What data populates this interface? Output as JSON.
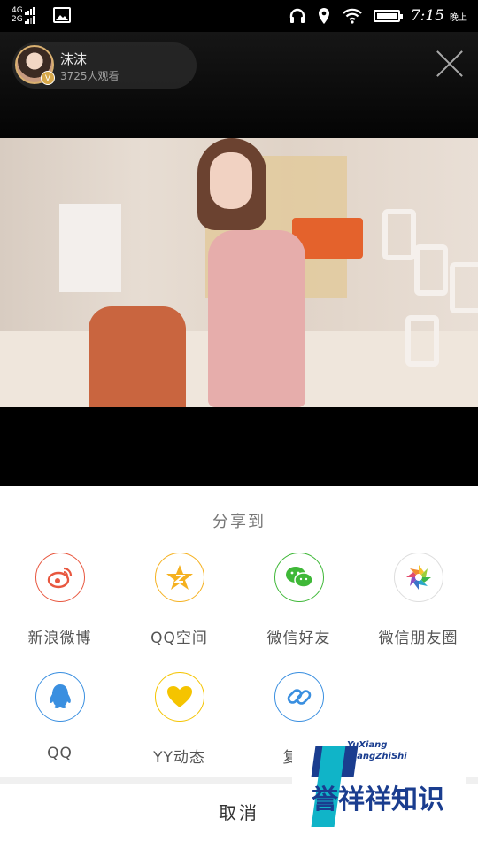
{
  "status_bar": {
    "network_top": "4G",
    "network_bottom": "2G",
    "time": "7:15",
    "period": "晚上"
  },
  "live": {
    "host_name": "沫沫",
    "viewers": "3725人观看",
    "badge_text": "V"
  },
  "share_sheet": {
    "title": "分享到",
    "items": [
      {
        "label": "新浪微博",
        "icon": "weibo-icon",
        "color": "#e8573f"
      },
      {
        "label": "QQ空间",
        "icon": "qzone-icon",
        "color": "#f5b120"
      },
      {
        "label": "微信好友",
        "icon": "wechat-icon",
        "color": "#3fb838"
      },
      {
        "label": "微信朋友圈",
        "icon": "moments-icon",
        "color": "#cccccc"
      },
      {
        "label": "QQ",
        "icon": "qq-icon",
        "color": "#3a8fe0"
      },
      {
        "label": "YY动态",
        "icon": "yy-heart-icon",
        "color": "#f5c400"
      },
      {
        "label": "复制",
        "icon": "link-icon",
        "color": "#3a8fe0"
      }
    ],
    "cancel": "取消"
  },
  "watermark": {
    "en_line1": "YuXiang",
    "en_line2": "XiangZhiShi",
    "zh_text": "誉祥祥知识"
  }
}
